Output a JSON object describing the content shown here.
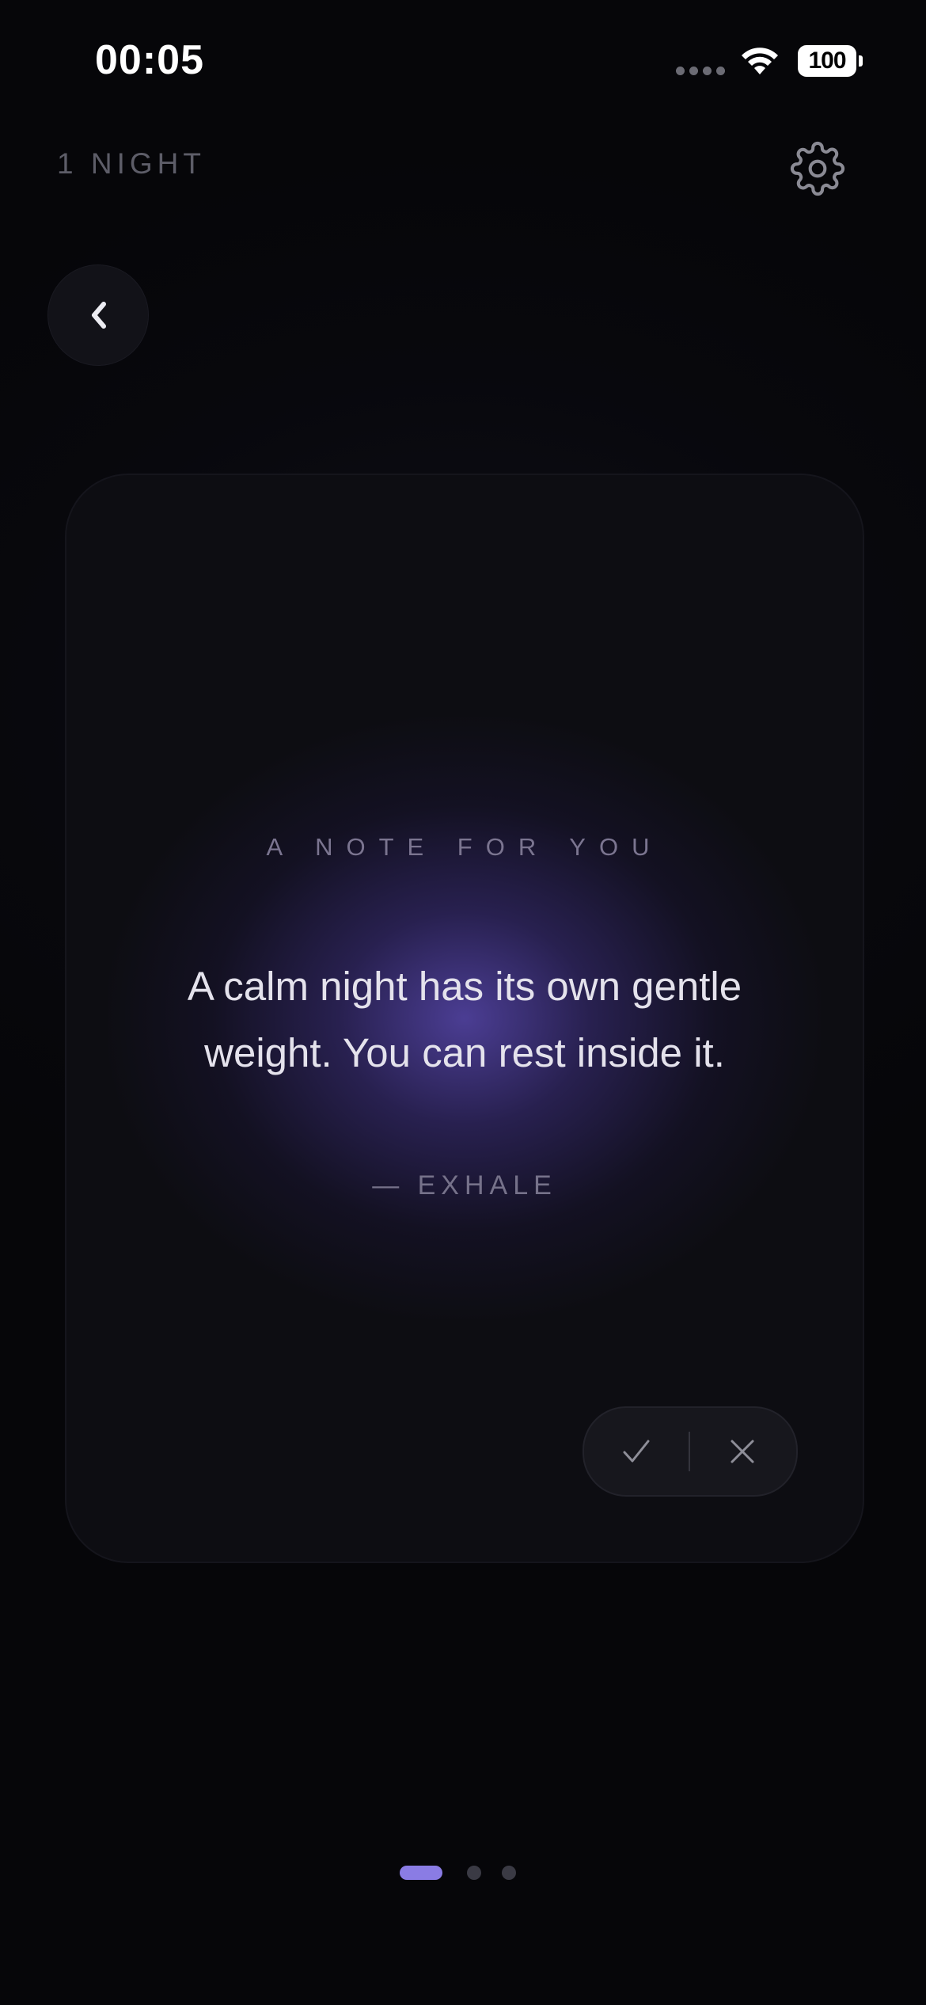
{
  "status_bar": {
    "time": "00:05",
    "battery": "100",
    "signal_icon": "signal-dots-icon",
    "wifi_icon": "wifi-icon",
    "battery_icon": "battery-icon"
  },
  "header": {
    "streak_label": "1 NIGHT",
    "settings_icon": "gear-icon",
    "back_icon": "chevron-left-icon"
  },
  "card": {
    "eyebrow": "A NOTE FOR YOU",
    "quote": "A calm night has its own gentle weight. You can rest inside it.",
    "author": "— EXHALE",
    "accept_icon": "checkmark-icon",
    "dismiss_icon": "close-icon"
  },
  "pagination": {
    "total_pages": 3,
    "current_page": 1
  },
  "colors": {
    "background": "#07070c",
    "card": "#0d0d12",
    "glow": "#5646aa",
    "accent_dot": "#8a7ce4"
  }
}
